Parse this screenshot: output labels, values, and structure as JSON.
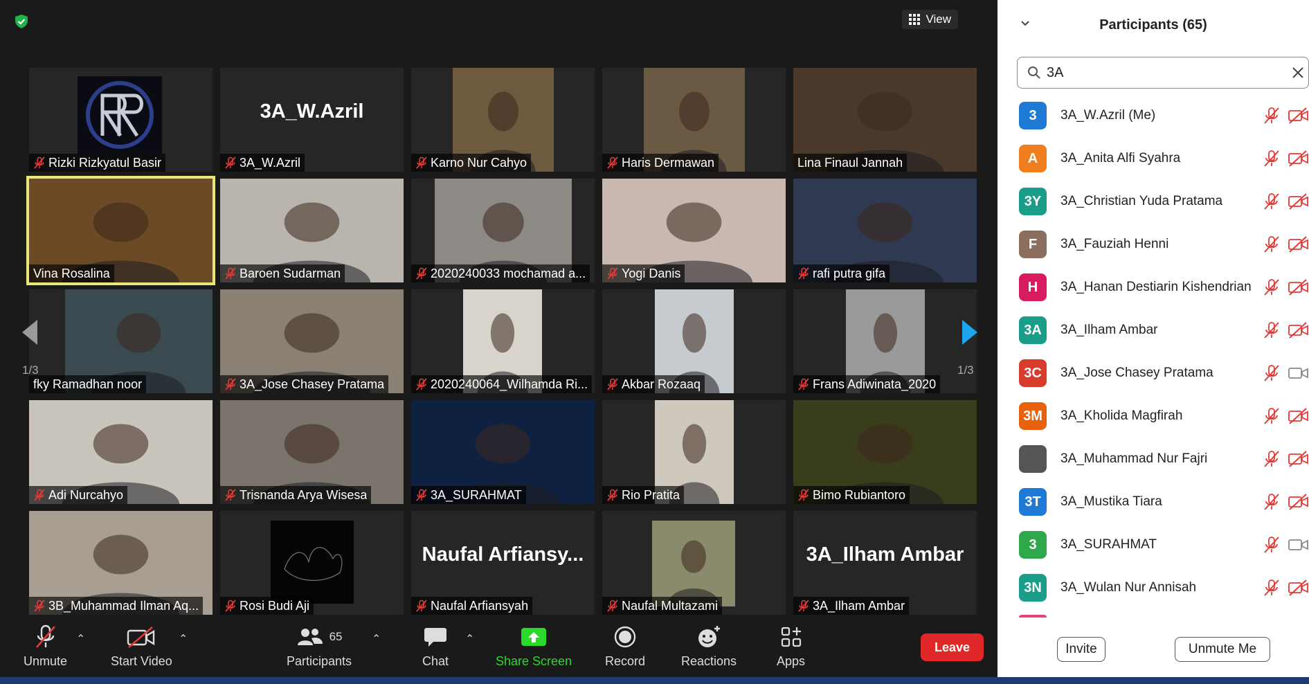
{
  "meeting": {
    "view_label": "View",
    "tiles": [
      {
        "name": "Rizki Rizkyatul Basir",
        "muted": true,
        "kind": "logo"
      },
      {
        "name": "3A_W.Azril",
        "muted": true,
        "kind": "text",
        "big": "3A_W.Azril"
      },
      {
        "name": "Karno Nur Cahyo",
        "muted": true,
        "kind": "video",
        "bg": "#6e5a3e"
      },
      {
        "name": "Haris Dermawan",
        "muted": true,
        "kind": "video",
        "bg": "#6a5a44"
      },
      {
        "name": "Lina Finaul Jannah",
        "muted": false,
        "kind": "video",
        "bg": "#4b3a2c"
      },
      {
        "name": "Vina Rosalina",
        "muted": false,
        "kind": "video",
        "bg": "#6b4a25",
        "active": true
      },
      {
        "name": "Baroen Sudarman",
        "muted": true,
        "kind": "video",
        "bg": "#b9b4ad"
      },
      {
        "name": "2020240033 mochamad a...",
        "muted": true,
        "kind": "video",
        "bg": "#8d8a86"
      },
      {
        "name": "Yogi Danis",
        "muted": true,
        "kind": "video",
        "bg": "#c8b8b0"
      },
      {
        "name": "rafi putra gifa",
        "muted": true,
        "kind": "video",
        "bg": "#2f3a52"
      },
      {
        "name": "fky Ramadhan noor",
        "muted": false,
        "kind": "video",
        "bg": "#3a4a50"
      },
      {
        "name": "3A_Jose Chasey Pratama",
        "muted": true,
        "kind": "video",
        "bg": "#8a8074"
      },
      {
        "name": "2020240064_Wilhamda Ri...",
        "muted": true,
        "kind": "video",
        "bg": "#d8d4cc"
      },
      {
        "name": "Akbar Rozaaq",
        "muted": true,
        "kind": "video",
        "bg": "#c6cbd0"
      },
      {
        "name": "Frans Adiwinata_2020",
        "muted": true,
        "kind": "video",
        "bg": "#9a9a9a"
      },
      {
        "name": "Adi Nurcahyo",
        "muted": true,
        "kind": "video",
        "bg": "#c9c4bc"
      },
      {
        "name": "Trisnanda Arya Wisesa",
        "muted": true,
        "kind": "video",
        "bg": "#7a746c"
      },
      {
        "name": "3A_SURAHMAT",
        "muted": true,
        "kind": "video",
        "bg": "#0e2140"
      },
      {
        "name": "Rio Pratita",
        "muted": true,
        "kind": "video",
        "bg": "#cfc8bd"
      },
      {
        "name": "Bimo Rubiantoro",
        "muted": true,
        "kind": "video",
        "bg": "#3a3d1c"
      },
      {
        "name": "3B_Muhammad Ilman Aq...",
        "muted": true,
        "kind": "video",
        "bg": "#a89f92"
      },
      {
        "name": "Rosi Budi Aji",
        "muted": true,
        "kind": "dark"
      },
      {
        "name": "Naufal Arfiansyah",
        "muted": true,
        "kind": "text",
        "big": "Naufal  Arfiansy..."
      },
      {
        "name": "Naufal Multazami",
        "muted": true,
        "kind": "video",
        "bg": "#8a8a6c"
      },
      {
        "name": "3A_Ilham Ambar",
        "muted": true,
        "kind": "text",
        "big": "3A_Ilham Ambar"
      }
    ],
    "page_left": "1/3",
    "page_right": "1/3"
  },
  "toolbar": {
    "unmute": "Unmute",
    "start_video": "Start Video",
    "participants": "Participants",
    "participants_count": "65",
    "chat": "Chat",
    "share_screen": "Share Screen",
    "record": "Record",
    "reactions": "Reactions",
    "apps": "Apps",
    "leave": "Leave"
  },
  "panel": {
    "title": "Participants (65)",
    "search_value": "3A",
    "participants": [
      {
        "initials": "3",
        "name": "3A_W.Azril (Me)",
        "color": "#1f7ad6",
        "cam": "off"
      },
      {
        "initials": "A",
        "name": "3A_Anita Alfi Syahra",
        "color": "#f07d1e",
        "cam": "off"
      },
      {
        "initials": "3Y",
        "name": "3A_Christian Yuda Pratama",
        "color": "#1a9e8a",
        "cam": "off"
      },
      {
        "initials": "F",
        "name": "3A_Fauziah Henni",
        "color": "#8b6f5e",
        "cam": "off"
      },
      {
        "initials": "H",
        "name": "3A_Hanan Destiarin Kishendrian",
        "color": "#d81b60",
        "cam": "off"
      },
      {
        "initials": "3A",
        "name": "3A_Ilham Ambar",
        "color": "#1a9e8a",
        "cam": "off"
      },
      {
        "initials": "3C",
        "name": "3A_Jose Chasey Pratama",
        "color": "#d83a2b",
        "cam": "on"
      },
      {
        "initials": "3M",
        "name": "3A_Kholida Magfirah",
        "color": "#e8620e",
        "cam": "off"
      },
      {
        "initials": "",
        "name": "3A_Muhammad Nur Fajri",
        "color": "#555555",
        "cam": "off"
      },
      {
        "initials": "3T",
        "name": "3A_Mustika Tiara",
        "color": "#1f7ad6",
        "cam": "off"
      },
      {
        "initials": "3",
        "name": "3A_SURAHMAT",
        "color": "#2ea84a",
        "cam": "on"
      },
      {
        "initials": "3N",
        "name": "3A_Wulan Nur Annisah",
        "color": "#1a9e8a",
        "cam": "off"
      }
    ],
    "invite": "Invite",
    "unmute_me": "Unmute Me"
  }
}
